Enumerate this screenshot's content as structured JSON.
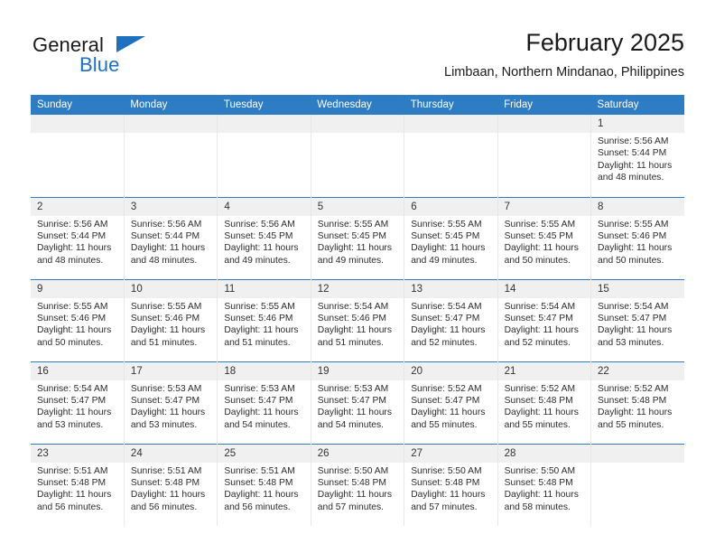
{
  "logo": {
    "word_primary": "General",
    "word_secondary": "Blue",
    "triangle_color": "#1f70c1",
    "primary_color": "#1a1a1a",
    "secondary_color": "#1f70c1"
  },
  "header": {
    "title": "February 2025",
    "subtitle": "Limbaan, Northern Mindanao, Philippines"
  },
  "theme": {
    "header_bg": "#2e7cc4",
    "header_text": "#ffffff",
    "daynum_bg": "#f0f0f0",
    "row_divider": "#2e7cc4",
    "col_divider": "#e6e6e6"
  },
  "weekdays": [
    "Sunday",
    "Monday",
    "Tuesday",
    "Wednesday",
    "Thursday",
    "Friday",
    "Saturday"
  ],
  "labels": {
    "sunrise_prefix": "Sunrise:",
    "sunset_prefix": "Sunset:",
    "daylight_prefix": "Daylight:"
  },
  "weeks": [
    [
      {
        "day": "",
        "empty": true
      },
      {
        "day": "",
        "empty": true
      },
      {
        "day": "",
        "empty": true
      },
      {
        "day": "",
        "empty": true
      },
      {
        "day": "",
        "empty": true
      },
      {
        "day": "",
        "empty": true
      },
      {
        "day": "1",
        "sunrise": "Sunrise: 5:56 AM",
        "sunset": "Sunset: 5:44 PM",
        "daylight_1": "Daylight: 11 hours",
        "daylight_2": "and 48 minutes."
      }
    ],
    [
      {
        "day": "2",
        "sunrise": "Sunrise: 5:56 AM",
        "sunset": "Sunset: 5:44 PM",
        "daylight_1": "Daylight: 11 hours",
        "daylight_2": "and 48 minutes."
      },
      {
        "day": "3",
        "sunrise": "Sunrise: 5:56 AM",
        "sunset": "Sunset: 5:44 PM",
        "daylight_1": "Daylight: 11 hours",
        "daylight_2": "and 48 minutes."
      },
      {
        "day": "4",
        "sunrise": "Sunrise: 5:56 AM",
        "sunset": "Sunset: 5:45 PM",
        "daylight_1": "Daylight: 11 hours",
        "daylight_2": "and 49 minutes."
      },
      {
        "day": "5",
        "sunrise": "Sunrise: 5:55 AM",
        "sunset": "Sunset: 5:45 PM",
        "daylight_1": "Daylight: 11 hours",
        "daylight_2": "and 49 minutes."
      },
      {
        "day": "6",
        "sunrise": "Sunrise: 5:55 AM",
        "sunset": "Sunset: 5:45 PM",
        "daylight_1": "Daylight: 11 hours",
        "daylight_2": "and 49 minutes."
      },
      {
        "day": "7",
        "sunrise": "Sunrise: 5:55 AM",
        "sunset": "Sunset: 5:45 PM",
        "daylight_1": "Daylight: 11 hours",
        "daylight_2": "and 50 minutes."
      },
      {
        "day": "8",
        "sunrise": "Sunrise: 5:55 AM",
        "sunset": "Sunset: 5:46 PM",
        "daylight_1": "Daylight: 11 hours",
        "daylight_2": "and 50 minutes."
      }
    ],
    [
      {
        "day": "9",
        "sunrise": "Sunrise: 5:55 AM",
        "sunset": "Sunset: 5:46 PM",
        "daylight_1": "Daylight: 11 hours",
        "daylight_2": "and 50 minutes."
      },
      {
        "day": "10",
        "sunrise": "Sunrise: 5:55 AM",
        "sunset": "Sunset: 5:46 PM",
        "daylight_1": "Daylight: 11 hours",
        "daylight_2": "and 51 minutes."
      },
      {
        "day": "11",
        "sunrise": "Sunrise: 5:55 AM",
        "sunset": "Sunset: 5:46 PM",
        "daylight_1": "Daylight: 11 hours",
        "daylight_2": "and 51 minutes."
      },
      {
        "day": "12",
        "sunrise": "Sunrise: 5:54 AM",
        "sunset": "Sunset: 5:46 PM",
        "daylight_1": "Daylight: 11 hours",
        "daylight_2": "and 51 minutes."
      },
      {
        "day": "13",
        "sunrise": "Sunrise: 5:54 AM",
        "sunset": "Sunset: 5:47 PM",
        "daylight_1": "Daylight: 11 hours",
        "daylight_2": "and 52 minutes."
      },
      {
        "day": "14",
        "sunrise": "Sunrise: 5:54 AM",
        "sunset": "Sunset: 5:47 PM",
        "daylight_1": "Daylight: 11 hours",
        "daylight_2": "and 52 minutes."
      },
      {
        "day": "15",
        "sunrise": "Sunrise: 5:54 AM",
        "sunset": "Sunset: 5:47 PM",
        "daylight_1": "Daylight: 11 hours",
        "daylight_2": "and 53 minutes."
      }
    ],
    [
      {
        "day": "16",
        "sunrise": "Sunrise: 5:54 AM",
        "sunset": "Sunset: 5:47 PM",
        "daylight_1": "Daylight: 11 hours",
        "daylight_2": "and 53 minutes."
      },
      {
        "day": "17",
        "sunrise": "Sunrise: 5:53 AM",
        "sunset": "Sunset: 5:47 PM",
        "daylight_1": "Daylight: 11 hours",
        "daylight_2": "and 53 minutes."
      },
      {
        "day": "18",
        "sunrise": "Sunrise: 5:53 AM",
        "sunset": "Sunset: 5:47 PM",
        "daylight_1": "Daylight: 11 hours",
        "daylight_2": "and 54 minutes."
      },
      {
        "day": "19",
        "sunrise": "Sunrise: 5:53 AM",
        "sunset": "Sunset: 5:47 PM",
        "daylight_1": "Daylight: 11 hours",
        "daylight_2": "and 54 minutes."
      },
      {
        "day": "20",
        "sunrise": "Sunrise: 5:52 AM",
        "sunset": "Sunset: 5:47 PM",
        "daylight_1": "Daylight: 11 hours",
        "daylight_2": "and 55 minutes."
      },
      {
        "day": "21",
        "sunrise": "Sunrise: 5:52 AM",
        "sunset": "Sunset: 5:48 PM",
        "daylight_1": "Daylight: 11 hours",
        "daylight_2": "and 55 minutes."
      },
      {
        "day": "22",
        "sunrise": "Sunrise: 5:52 AM",
        "sunset": "Sunset: 5:48 PM",
        "daylight_1": "Daylight: 11 hours",
        "daylight_2": "and 55 minutes."
      }
    ],
    [
      {
        "day": "23",
        "sunrise": "Sunrise: 5:51 AM",
        "sunset": "Sunset: 5:48 PM",
        "daylight_1": "Daylight: 11 hours",
        "daylight_2": "and 56 minutes."
      },
      {
        "day": "24",
        "sunrise": "Sunrise: 5:51 AM",
        "sunset": "Sunset: 5:48 PM",
        "daylight_1": "Daylight: 11 hours",
        "daylight_2": "and 56 minutes."
      },
      {
        "day": "25",
        "sunrise": "Sunrise: 5:51 AM",
        "sunset": "Sunset: 5:48 PM",
        "daylight_1": "Daylight: 11 hours",
        "daylight_2": "and 56 minutes."
      },
      {
        "day": "26",
        "sunrise": "Sunrise: 5:50 AM",
        "sunset": "Sunset: 5:48 PM",
        "daylight_1": "Daylight: 11 hours",
        "daylight_2": "and 57 minutes."
      },
      {
        "day": "27",
        "sunrise": "Sunrise: 5:50 AM",
        "sunset": "Sunset: 5:48 PM",
        "daylight_1": "Daylight: 11 hours",
        "daylight_2": "and 57 minutes."
      },
      {
        "day": "28",
        "sunrise": "Sunrise: 5:50 AM",
        "sunset": "Sunset: 5:48 PM",
        "daylight_1": "Daylight: 11 hours",
        "daylight_2": "and 58 minutes."
      },
      {
        "day": "",
        "empty": true
      }
    ]
  ]
}
